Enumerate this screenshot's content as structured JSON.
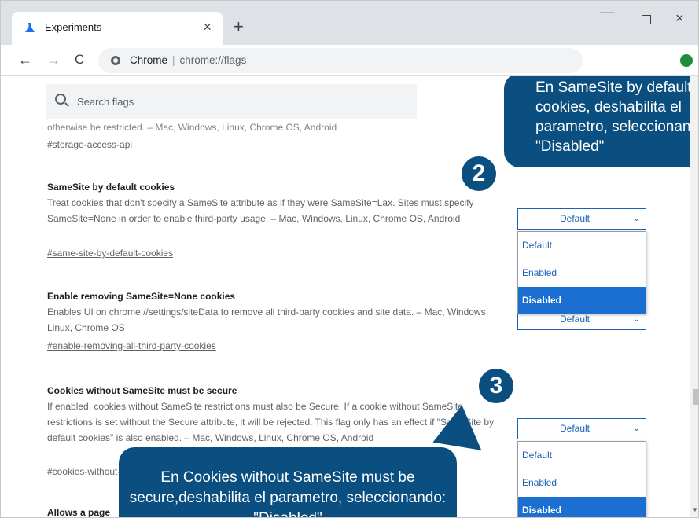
{
  "browser": {
    "tab_title": "Experiments",
    "tab_close": "×",
    "new_tab": "+",
    "win_min": "—",
    "win_close": "×",
    "nav_back": "←",
    "nav_forward": "→",
    "nav_reload": "C",
    "omnibox_site": "Chrome",
    "omnibox_sep": "|",
    "omnibox_url": "chrome://flags"
  },
  "search": {
    "placeholder": "Search flags"
  },
  "cut_text": "otherwise be restricted. – Mac, Windows, Linux, Chrome OS, Android",
  "flags": [
    {
      "link": "#storage-access-api"
    },
    {
      "title": "SameSite by default cookies",
      "desc": "Treat cookies that don't specify a SameSite attribute as if they were SameSite=Lax. Sites must specify SameSite=None in order to enable third-party usage. – Mac, Windows, Linux, Chrome OS, Android",
      "link": "#same-site-by-default-cookies",
      "select_value": "Default"
    },
    {
      "title": "Enable removing SameSite=None cookies",
      "desc": "Enables UI on chrome://settings/siteData to remove all third-party cookies and site data. – Mac, Windows, Linux, Chrome OS",
      "link": "#enable-removing-all-third-party-cookies",
      "select_value": "Default"
    },
    {
      "title": "Cookies without SameSite must be secure",
      "desc": "If enabled, cookies without SameSite restrictions must also be Secure. If a cookie without SameSite restrictions is set without the Secure attribute, it will be rejected. This flag only has an effect if \"SameSite by default cookies\" is also enabled. – Mac, Windows, Linux, Chrome OS, Android",
      "link": "#cookies-without-same-site-must-be-secure",
      "select_value": "Default"
    },
    {
      "title": "Allows a page"
    }
  ],
  "dropdown_options": [
    "Default",
    "Enabled",
    "Disabled"
  ],
  "dropdown_selected": "Disabled",
  "select_chevron": "⌄",
  "callouts": {
    "top": "En SameSite by default cookies, deshabilita el parametro, seleccionando: \"Disabled\"",
    "bottom": "En Cookies without SameSite must be secure,deshabilita el parametro, seleccionando: \"Disabled\""
  },
  "steps": [
    "2",
    "3"
  ],
  "colors": {
    "callout": "#0b4f80",
    "select_accent": "#1a62b7",
    "selected_option": "#1a6fd1"
  },
  "icons": {
    "favicon": "flask-icon",
    "search": "search-icon",
    "site": "site-info-icon"
  }
}
